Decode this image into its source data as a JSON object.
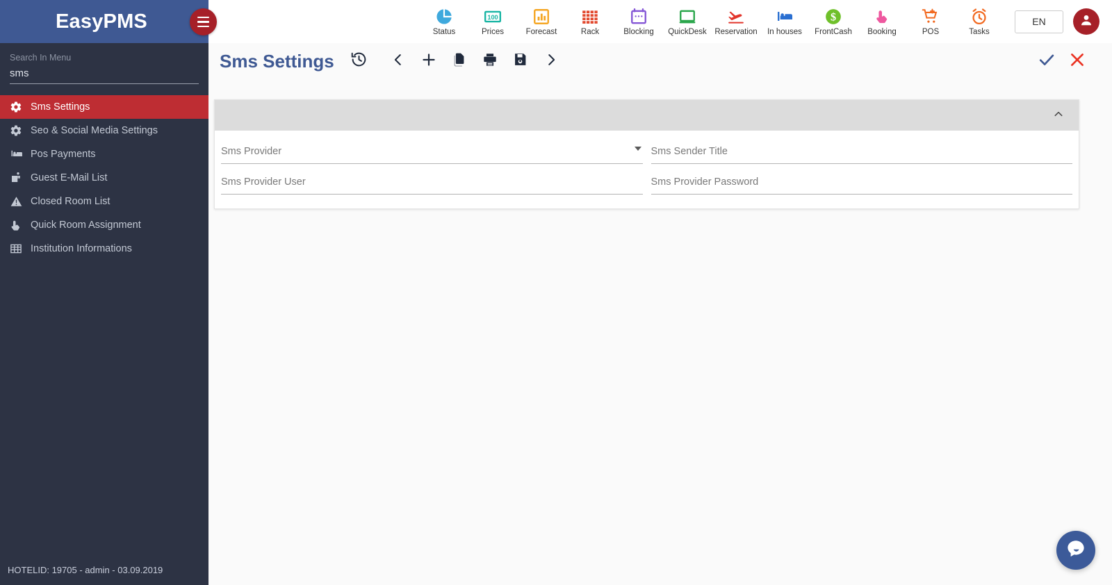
{
  "brand": {
    "name": "EasyPMS",
    "menu_icon": "hamburger-icon"
  },
  "sidebar": {
    "search": {
      "label": "Search In Menu",
      "value": "sms",
      "placeholder": ""
    },
    "items": [
      {
        "label": "Sms Settings",
        "icon": "gear-icon",
        "active": true
      },
      {
        "label": "Seo & Social Media Settings",
        "icon": "gear-icon",
        "active": false
      },
      {
        "label": "Pos Payments",
        "icon": "bed-icon",
        "active": false
      },
      {
        "label": "Guest E-Mail List",
        "icon": "mailbox-icon",
        "active": false
      },
      {
        "label": "Closed Room List",
        "icon": "warning-triangle-icon",
        "active": false
      },
      {
        "label": "Quick Room Assignment",
        "icon": "hand-pointer-icon",
        "active": false
      },
      {
        "label": "Institution Informations",
        "icon": "table-grid-icon",
        "active": false
      }
    ],
    "footer": "HOTELID: 19705 - admin - 03.09.2019"
  },
  "topnav": {
    "items": [
      {
        "label": "Status",
        "icon": "pie-chart-icon",
        "color": "#3fa9dd"
      },
      {
        "label": "Prices",
        "icon": "money-100-icon",
        "color": "#19b5a4"
      },
      {
        "label": "Forecast",
        "icon": "bar-chart-icon",
        "color": "#f5a623"
      },
      {
        "label": "Rack",
        "icon": "grid-squares-icon",
        "color": "#e2492e"
      },
      {
        "label": "Blocking",
        "icon": "calendar-icon",
        "color": "#8557d6"
      },
      {
        "label": "QuickDesk",
        "icon": "monitor-icon",
        "color": "#2aa64b"
      },
      {
        "label": "Reservation",
        "icon": "plane-landing-icon",
        "color": "#e2342a"
      },
      {
        "label": "In houses",
        "icon": "bed-icon",
        "color": "#2a6fd1"
      },
      {
        "label": "FrontCash",
        "icon": "dollar-circle-icon",
        "color": "#6fc02a"
      },
      {
        "label": "Booking",
        "icon": "hand-pointer-icon",
        "color": "#ee589f"
      },
      {
        "label": "POS",
        "icon": "cart-plus-icon",
        "color": "#f26a21"
      },
      {
        "label": "Tasks",
        "icon": "alarm-clock-icon",
        "color": "#f26a21"
      }
    ],
    "language": "EN",
    "account_icon": "user-avatar-icon"
  },
  "page": {
    "title": "Sms Settings",
    "toolbar": [
      {
        "name": "history",
        "icon": "history-restore-icon"
      },
      {
        "name": "previous",
        "icon": "chevron-left-icon"
      },
      {
        "name": "add",
        "icon": "plus-icon"
      },
      {
        "name": "duplicate",
        "icon": "copy-icon"
      },
      {
        "name": "print",
        "icon": "printer-icon"
      },
      {
        "name": "save",
        "icon": "floppy-disk-icon"
      },
      {
        "name": "next",
        "icon": "chevron-right-icon"
      }
    ],
    "confirm_icon": "check-icon",
    "cancel_icon": "close-x-icon",
    "accent_blue": "#3f5993",
    "accent_red": "#ea3323"
  },
  "panel": {
    "collapse_icon": "chevron-up-icon",
    "fields": [
      {
        "label": "Sms Provider",
        "value": "",
        "type": "select"
      },
      {
        "label": "Sms Sender Title",
        "value": "",
        "type": "text"
      },
      {
        "label": "Sms Provider User",
        "value": "",
        "type": "text"
      },
      {
        "label": "Sms Provider Password",
        "value": "",
        "type": "text"
      }
    ]
  },
  "chat": {
    "icon": "chat-bubble-icon",
    "color": "#3c5a99"
  }
}
